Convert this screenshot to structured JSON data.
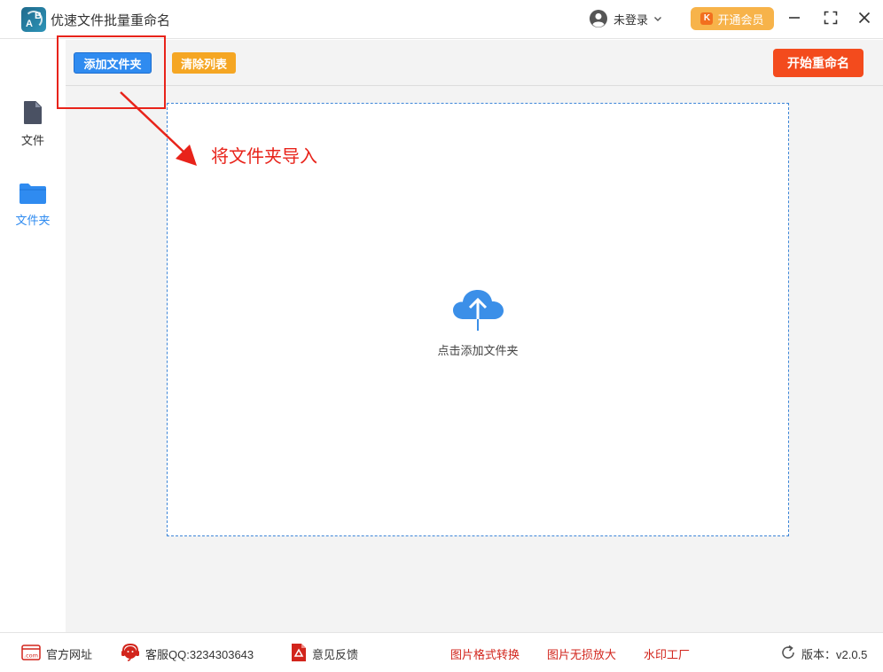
{
  "window": {
    "title": "优速文件批量重命名",
    "logo_letters": [
      "A",
      "B"
    ]
  },
  "header": {
    "user_label": "未登录",
    "vip_label": "开通会员",
    "vip_icon_letter": "K"
  },
  "sidebar": {
    "items": [
      {
        "label": "文件",
        "icon": "file-icon",
        "active": false
      },
      {
        "label": "文件夹",
        "icon": "folder-icon",
        "active": true
      }
    ]
  },
  "toolbar": {
    "add_label": "添加文件夹",
    "clear_label": "清除列表",
    "start_label": "开始重命名"
  },
  "dropzone": {
    "text": "点击添加文件夹",
    "icon": "cloud-upload-icon"
  },
  "annotation": {
    "text": "将文件夹导入"
  },
  "footer": {
    "website": "官方网址",
    "qq": "客服QQ:3234303643",
    "feedback": "意见反馈",
    "link1": "图片格式转换",
    "link2": "图片无损放大",
    "link3": "水印工厂",
    "version": "版本：v2.0.5"
  },
  "colors": {
    "primary": "#2f8bf0",
    "warning": "#f5a623",
    "danger": "#f34b1d",
    "vip": "#f7b34a",
    "annotation": "#e8231a"
  }
}
